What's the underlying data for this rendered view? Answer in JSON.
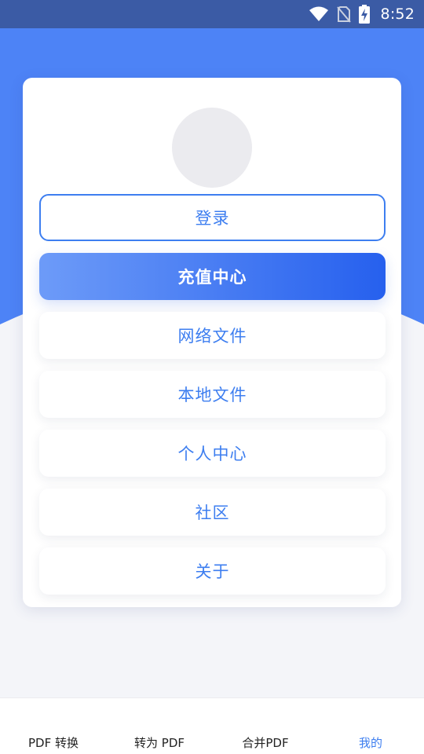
{
  "status_bar": {
    "time": "8:52",
    "icons": [
      "wifi-icon",
      "no-sim-icon",
      "battery-charging-icon"
    ]
  },
  "card": {
    "avatar": "avatar-placeholder",
    "buttons": {
      "login": "登录",
      "recharge": "充值中心",
      "network_files": "网络文件",
      "local_files": "本地文件",
      "personal_center": "个人中心",
      "community": "社区",
      "about": "关于"
    }
  },
  "bottom_nav": {
    "items": [
      "PDF 转换",
      "转为 PDF",
      "合并PDF",
      "我的"
    ],
    "active_index": 3
  },
  "colors": {
    "header_blue": "#4d83f6",
    "status_bar": "#3b5ba5",
    "accent": "#3d7ef0",
    "gradient_start": "#6d9bf8",
    "gradient_end": "#2660ee",
    "background": "#f4f5f9"
  }
}
